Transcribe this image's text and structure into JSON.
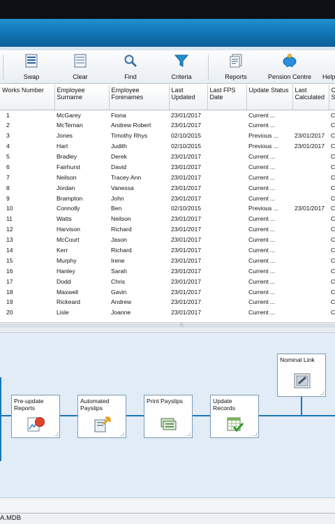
{
  "toolbar": {
    "buttons": [
      {
        "label": "Swap",
        "icon": "swap-icon"
      },
      {
        "label": "Clear",
        "icon": "clear-icon"
      },
      {
        "label": "Find",
        "icon": "find-icon"
      },
      {
        "label": "Criteria",
        "icon": "criteria-funnel-icon"
      },
      {
        "label": "Reports",
        "icon": "reports-icon"
      },
      {
        "label": "Pension Centre",
        "icon": "pension-piggy-icon"
      },
      {
        "label": "Help",
        "icon": "help-icon"
      }
    ]
  },
  "grid": {
    "headers": {
      "works_number": "Works Number",
      "surname": "Employee Surname",
      "forenames": "Employee Forenames",
      "last_updated": "Last Updated",
      "last_fps": "Last FPS Date",
      "update_status": "Update Status",
      "last_calculated": "Last Calculated",
      "extra": "C S"
    },
    "rows": [
      {
        "wn": "1",
        "surname": "McGarey",
        "forenames": "Fiona",
        "updated": "23/01/2017",
        "fps": "",
        "status": "Current ...",
        "calc": "",
        "extra": "C"
      },
      {
        "wn": "2",
        "surname": "McTernan",
        "forenames": "Andrew Robert",
        "updated": "23/01/2017",
        "fps": "",
        "status": "Current ...",
        "calc": "",
        "extra": "C"
      },
      {
        "wn": "3",
        "surname": "Jones",
        "forenames": "Timothy Rhys",
        "updated": "02/10/2015",
        "fps": "",
        "status": "Previous ...",
        "calc": "23/01/2017",
        "extra": "C"
      },
      {
        "wn": "4",
        "surname": "Hart",
        "forenames": "Judith",
        "updated": "02/10/2015",
        "fps": "",
        "status": "Previous ...",
        "calc": "23/01/2017",
        "extra": "C"
      },
      {
        "wn": "5",
        "surname": "Bradley",
        "forenames": "Derek",
        "updated": "23/01/2017",
        "fps": "",
        "status": "Current ...",
        "calc": "",
        "extra": "C"
      },
      {
        "wn": "6",
        "surname": "Fairhurst",
        "forenames": "David",
        "updated": "23/01/2017",
        "fps": "",
        "status": "Current ...",
        "calc": "",
        "extra": "C"
      },
      {
        "wn": "7",
        "surname": "Neilson",
        "forenames": "Tracey Ann",
        "updated": "23/01/2017",
        "fps": "",
        "status": "Current ...",
        "calc": "",
        "extra": "C"
      },
      {
        "wn": "8",
        "surname": "Jordan",
        "forenames": "Vanessa",
        "updated": "23/01/2017",
        "fps": "",
        "status": "Current ...",
        "calc": "",
        "extra": "C"
      },
      {
        "wn": "9",
        "surname": "Brampton",
        "forenames": "John",
        "updated": "23/01/2017",
        "fps": "",
        "status": "Current ...",
        "calc": "",
        "extra": "C"
      },
      {
        "wn": "10",
        "surname": "Connolly",
        "forenames": "Ben",
        "updated": "02/10/2015",
        "fps": "",
        "status": "Previous ...",
        "calc": "23/01/2017",
        "extra": "C"
      },
      {
        "wn": "11",
        "surname": "Watts",
        "forenames": "Neilson",
        "updated": "23/01/2017",
        "fps": "",
        "status": "Current ...",
        "calc": "",
        "extra": "C"
      },
      {
        "wn": "12",
        "surname": "Harvison",
        "forenames": "Richard",
        "updated": "23/01/2017",
        "fps": "",
        "status": "Current ...",
        "calc": "",
        "extra": "C"
      },
      {
        "wn": "13",
        "surname": "McCourt",
        "forenames": "Jason",
        "updated": "23/01/2017",
        "fps": "",
        "status": "Current ...",
        "calc": "",
        "extra": "C"
      },
      {
        "wn": "14",
        "surname": "Kerr",
        "forenames": "Richard",
        "updated": "23/01/2017",
        "fps": "",
        "status": "Current ...",
        "calc": "",
        "extra": "C"
      },
      {
        "wn": "15",
        "surname": "Murphy",
        "forenames": "Irene",
        "updated": "23/01/2017",
        "fps": "",
        "status": "Current ...",
        "calc": "",
        "extra": "C"
      },
      {
        "wn": "16",
        "surname": "Hanley",
        "forenames": "Sarah",
        "updated": "23/01/2017",
        "fps": "",
        "status": "Current ...",
        "calc": "",
        "extra": "C"
      },
      {
        "wn": "17",
        "surname": "Dodd",
        "forenames": "Chris",
        "updated": "23/01/2017",
        "fps": "",
        "status": "Current ...",
        "calc": "",
        "extra": "C"
      },
      {
        "wn": "18",
        "surname": "Maxwell",
        "forenames": "Gavin",
        "updated": "23/01/2017",
        "fps": "",
        "status": "Current ...",
        "calc": "",
        "extra": "C"
      },
      {
        "wn": "19",
        "surname": "Rickeard",
        "forenames": "Andrew",
        "updated": "23/01/2017",
        "fps": "",
        "status": "Current ...",
        "calc": "",
        "extra": "C"
      },
      {
        "wn": "20",
        "surname": "Lisle",
        "forenames": "Joanne",
        "updated": "23/01/2017",
        "fps": "",
        "status": "Current ...",
        "calc": "",
        "extra": "C"
      }
    ]
  },
  "workflow": {
    "steps": [
      {
        "title": "Pre-update Reports",
        "icon": "pre-update-reports-icon"
      },
      {
        "title": "Automated Payslips",
        "icon": "automated-payslips-icon"
      },
      {
        "title": "Print Payslips",
        "icon": "print-payslips-icon"
      },
      {
        "title": "Update Records",
        "icon": "update-records-icon"
      },
      {
        "title": "Nominal Link",
        "icon": "nominal-link-icon"
      }
    ],
    "line_color": "#1a77b8"
  },
  "statusbar": {
    "text": "A.MDB"
  }
}
